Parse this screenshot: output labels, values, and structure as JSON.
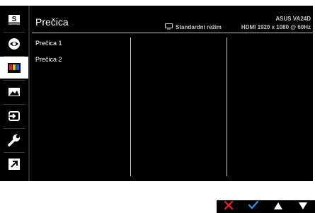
{
  "sidebar": {
    "items": [
      {
        "icon": "splendid-icon",
        "active": false
      },
      {
        "icon": "eye-care-icon",
        "active": false
      },
      {
        "icon": "color-icon",
        "active": true
      },
      {
        "icon": "image-icon",
        "active": false
      },
      {
        "icon": "input-select-icon",
        "active": false
      },
      {
        "icon": "system-setup-icon",
        "active": false
      },
      {
        "icon": "shortcut-icon",
        "active": false
      }
    ]
  },
  "header": {
    "title": "Prečica",
    "mode_label": "Standardni režim",
    "mode_icon": "monitor-icon",
    "model": "ASUS VA24D",
    "signal": "HDMI 1920 x 1080 @ 60Hz"
  },
  "menu": {
    "items": [
      "Prečica 1",
      "Prečica 2"
    ]
  },
  "nav": {
    "buttons": [
      {
        "icon": "close-icon",
        "color": "#e02020"
      },
      {
        "icon": "check-icon",
        "color": "#2a8fe0"
      },
      {
        "icon": "up-icon",
        "color": "#ffffff"
      },
      {
        "icon": "down-icon",
        "color": "#ffffff"
      }
    ]
  },
  "colors": {
    "background": "#000000",
    "text": "#ffffff",
    "active_item": "#ffffff"
  }
}
